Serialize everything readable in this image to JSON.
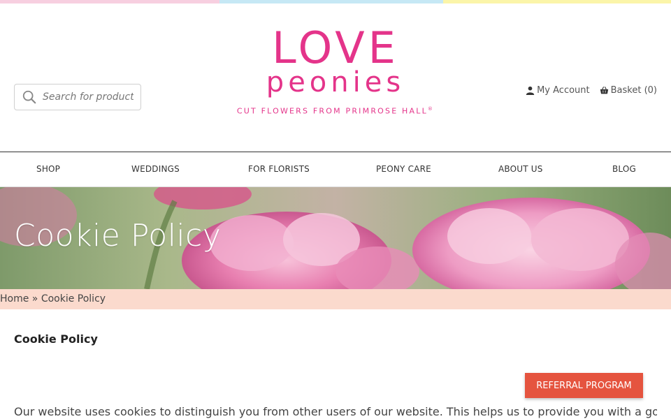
{
  "search": {
    "placeholder": "Search for products.."
  },
  "logo": {
    "line1": "LOVE",
    "line2": "peonies",
    "tagline": "CUT FLOWERS FROM PRIMROSE HALL",
    "mark": "®"
  },
  "account": {
    "my_account": "My Account",
    "basket": "Basket (0)"
  },
  "nav": [
    "SHOP",
    "WEDDINGS",
    "FOR FLORISTS",
    "PEONY CARE",
    "ABOUT US",
    "BLOG"
  ],
  "hero": {
    "title": "Cookie Policy"
  },
  "breadcrumb": {
    "home": "Home",
    "sep": " » ",
    "current": "Cookie Policy"
  },
  "content": {
    "heading": "Cookie Policy",
    "referral": "REFERRAL PROGRAM",
    "paragraph": "Our website uses cookies to distinguish you from other users of our website. This helps us to provide you with a good"
  },
  "colors": {
    "brand_pink": "#e4348a",
    "breadcrumb_bg": "#fbdacd",
    "referral_bg": "#e5543f"
  }
}
